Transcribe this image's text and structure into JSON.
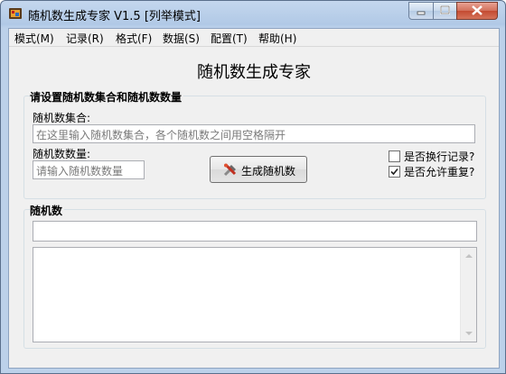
{
  "window": {
    "title": "随机数生成专家 V1.5 [列举模式]"
  },
  "menu": [
    "模式(M)",
    "记录(R)",
    "格式(F)",
    "数据(S)",
    "配置(T)",
    "帮助(H)"
  ],
  "heading": "随机数生成专家",
  "settings": {
    "group_title": "请设置随机数集合和随机数数量",
    "set_label": "随机数集合:",
    "set_placeholder": "在这里输入随机数集合，各个随机数之间用空格隔开",
    "count_label": "随机数数量:",
    "count_placeholder": "请输入随机数数量",
    "generate_label": "生成随机数",
    "newline_label": "是否换行记录?",
    "newline_checked": false,
    "repeat_label": "是否允许重复?",
    "repeat_checked": true
  },
  "results": {
    "group_title": "随机数"
  }
}
